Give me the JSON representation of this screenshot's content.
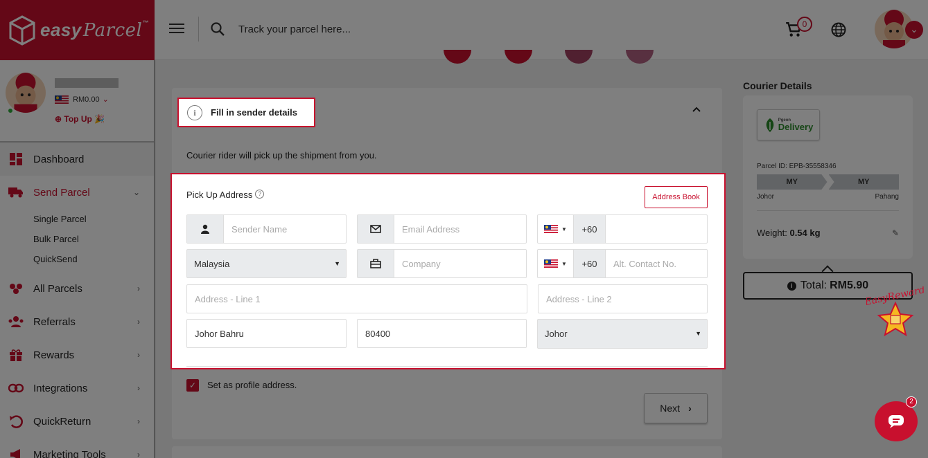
{
  "header": {
    "brand": "easy",
    "brand_script": "Parcel",
    "trademark": "™",
    "search_placeholder": "Track your parcel here...",
    "cart_count": "0"
  },
  "profile": {
    "balance": "RM0.00",
    "topup_label": "Top Up"
  },
  "sidebar": {
    "items": [
      {
        "label": "Dashboard"
      },
      {
        "label": "Send Parcel"
      },
      {
        "label": "All Parcels"
      },
      {
        "label": "Referrals"
      },
      {
        "label": "Rewards"
      },
      {
        "label": "Integrations"
      },
      {
        "label": "QuickReturn"
      },
      {
        "label": "Marketing Tools"
      }
    ],
    "sub_items": [
      {
        "label": "Single Parcel"
      },
      {
        "label": "Bulk Parcel"
      },
      {
        "label": "QuickSend"
      }
    ]
  },
  "sender": {
    "step_title": "Fill in sender details",
    "pickup_note": "Courier rider will pick up the shipment from you.",
    "form_title": "Pick Up Address",
    "address_book": "Address Book",
    "fields": {
      "name_placeholder": "Sender Name",
      "email_placeholder": "Email Address",
      "country_code": "+60",
      "country": "Malaysia",
      "company_placeholder": "Company",
      "alt_contact_placeholder": "Alt. Contact No.",
      "address1_placeholder": "Address - Line 1",
      "address2_placeholder": "Address - Line 2",
      "city": "Johor Bahru",
      "postcode": "80400",
      "state": "Johor"
    },
    "profile_checkbox_label": "Set as profile address.",
    "next_label": "Next"
  },
  "courier": {
    "title": "Courier Details",
    "logo_text": "Delivery",
    "logo_small": "Pgeon",
    "parcel_id": "Parcel ID: EPB-35558346",
    "from_country": "MY",
    "to_country": "MY",
    "from_state": "Johor",
    "to_state": "Pahang",
    "weight_label": "Weight:",
    "weight_value": "0.54 kg",
    "total_label": "Total:",
    "total_value": "RM5.90"
  },
  "reward_badge": "EasyReward",
  "chat_badge": "2",
  "colors": {
    "brand": "#c8102e",
    "overlay": "rgba(0,0,0,0.5)"
  }
}
